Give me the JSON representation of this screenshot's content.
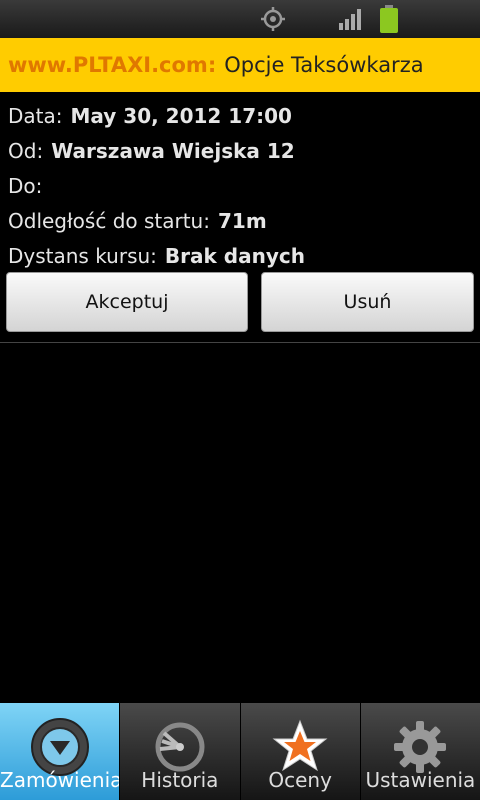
{
  "status_bar": {
    "icons": [
      "gps-icon",
      "signal-icon",
      "battery-icon"
    ],
    "battery_color": "#8cc820"
  },
  "title_bar": {
    "site": "www.PLTAXI.com:",
    "title": "Opcje Taksówkarza",
    "background_color": "#ffcc00",
    "site_color": "#e07800"
  },
  "order": {
    "date_label": "Data:",
    "date_value": "May 30, 2012 17:00",
    "from_label": "Od:",
    "from_value": "Warszawa Wiejska 12",
    "to_label": "Do:",
    "to_value": "",
    "distance_to_start_label": "Odległość do startu:",
    "distance_to_start_value": "71m",
    "trip_distance_label": "Dystans kursu:",
    "trip_distance_value": "Brak danych"
  },
  "actions": {
    "accept_label": "Akceptuj",
    "delete_label": "Usuń"
  },
  "tabs": [
    {
      "label": "Zamówienia",
      "icon": "orders-icon",
      "active": true
    },
    {
      "label": "Historia",
      "icon": "history-icon",
      "active": false
    },
    {
      "label": "Oceny",
      "icon": "star-icon",
      "active": false
    },
    {
      "label": "Ustawienia",
      "icon": "gear-icon",
      "active": false
    }
  ],
  "colors": {
    "active_tab": "#2d9cd8",
    "star": "#f07020"
  }
}
